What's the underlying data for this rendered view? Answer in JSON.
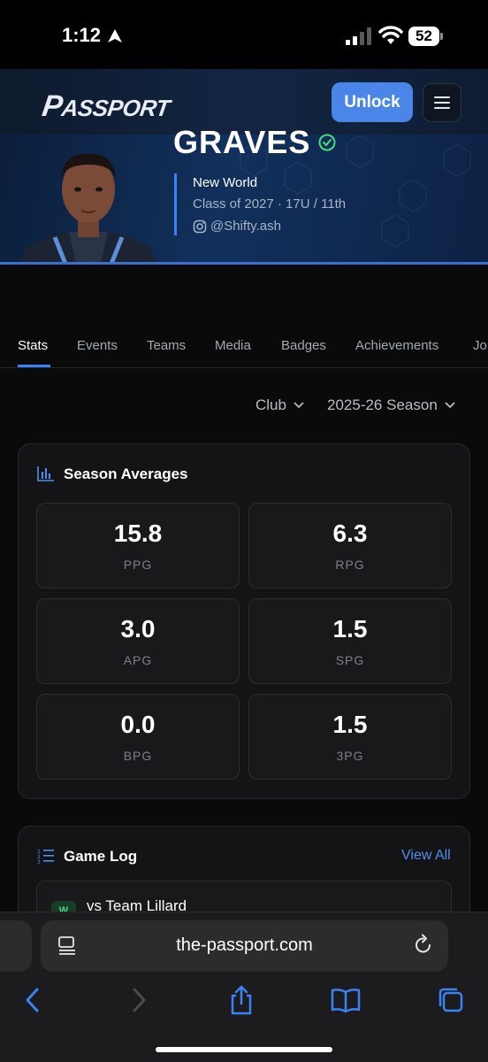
{
  "status_bar": {
    "time": "1:12",
    "battery": "52"
  },
  "header": {
    "logo": "PASSPORT",
    "logo_first": "P",
    "logo_rest": "ASSPORT",
    "unlock_label": "Unlock"
  },
  "player": {
    "name": "GRAVES",
    "team": "New World",
    "class_line": "Class of 2027 · 17U / 11th",
    "handle": "@Shifty.ash"
  },
  "tabs": [
    "Stats",
    "Events",
    "Teams",
    "Media",
    "Badges",
    "Achievements",
    "Jo"
  ],
  "filters": {
    "league": "Club",
    "season": "2025-26 Season"
  },
  "season_averages": {
    "title": "Season Averages",
    "stats": [
      {
        "value": "15.8",
        "label": "PPG"
      },
      {
        "value": "6.3",
        "label": "RPG"
      },
      {
        "value": "3.0",
        "label": "APG"
      },
      {
        "value": "1.5",
        "label": "SPG"
      },
      {
        "value": "0.0",
        "label": "BPG"
      },
      {
        "value": "1.5",
        "label": "3PG"
      }
    ]
  },
  "game_log": {
    "title": "Game Log",
    "view_all": "View All",
    "games": [
      {
        "result": "W",
        "opponent": "vs Team Lillard"
      }
    ]
  },
  "browser": {
    "url": "the-passport.com"
  },
  "colors": {
    "accent": "#3b82f6",
    "unlock": "#4a86e8",
    "link": "#4f8ff0",
    "verified": "#4ade80"
  }
}
